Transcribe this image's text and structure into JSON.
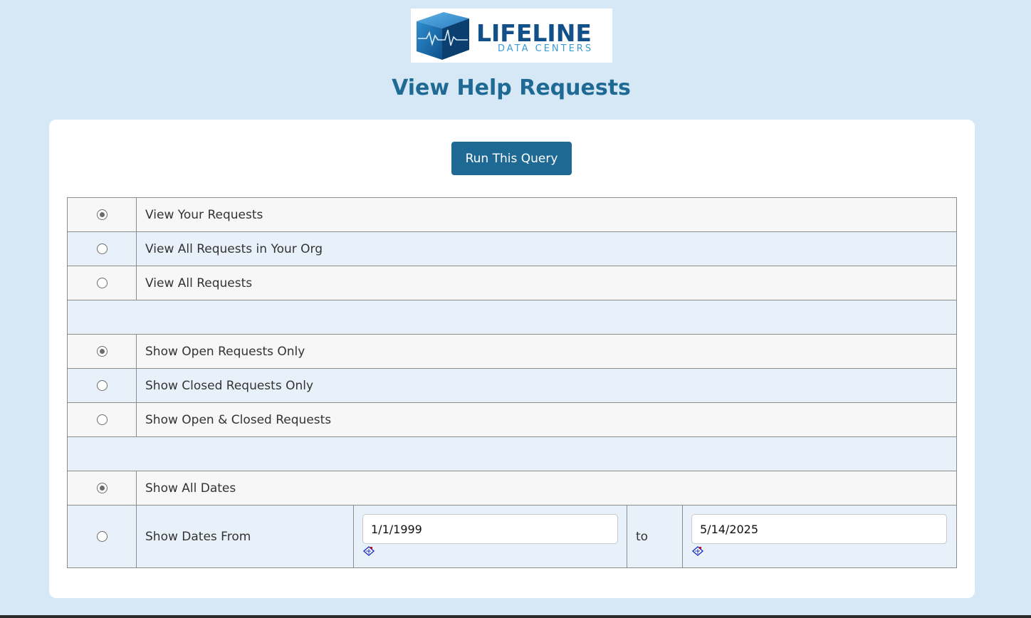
{
  "header": {
    "logo": {
      "brand_name": "LIFELINE",
      "brand_sub": "DATA CENTERS"
    },
    "title": "View Help Requests"
  },
  "query": {
    "run_label": "Run This Query"
  },
  "scope_options": [
    {
      "label": "View Your Requests",
      "checked": true
    },
    {
      "label": "View All Requests in Your Org",
      "checked": false
    },
    {
      "label": "View All Requests",
      "checked": false
    }
  ],
  "status_options": [
    {
      "label": "Show Open Requests Only",
      "checked": true
    },
    {
      "label": "Show Closed Requests Only",
      "checked": false
    },
    {
      "label": "Show Open & Closed Requests",
      "checked": false
    }
  ],
  "date_options": {
    "all_dates": {
      "label": "Show All Dates",
      "checked": true
    },
    "range": {
      "label": "Show Dates From",
      "checked": false,
      "from_value": "1/1/1999",
      "to_label": "to",
      "to_value": "5/14/2025"
    }
  },
  "colors": {
    "background": "#d6e8f5",
    "accent": "#1f6a94",
    "row_light": "#f7f7f7",
    "row_blue": "#e8f1f9"
  },
  "icons": {
    "calendar": "calendar-icon",
    "logo": "lifeline-cube-logo"
  }
}
